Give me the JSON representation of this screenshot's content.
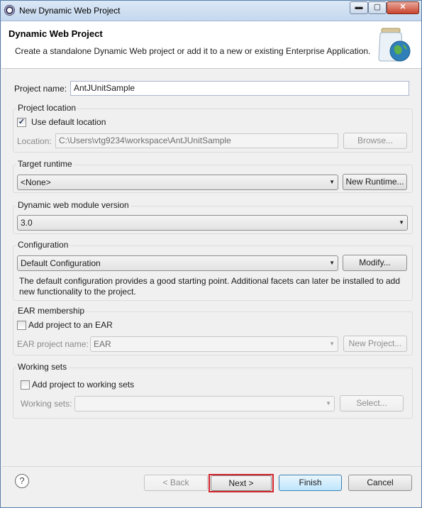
{
  "window": {
    "title": "New Dynamic Web Project",
    "controls": {
      "minimize": "▬",
      "maximize": "▢",
      "close": "✕"
    }
  },
  "header": {
    "title": "Dynamic Web Project",
    "description": "Create a standalone Dynamic Web project or add it to a new or existing Enterprise Application.",
    "graphic_icon": "jar-globe-icon"
  },
  "project_name": {
    "label": "Project name:",
    "value": "AntJUnitSample"
  },
  "project_location": {
    "group_title": "Project location",
    "use_default_label": "Use default location",
    "use_default_checked": true,
    "location_label": "Location:",
    "location_value": "C:\\Users\\vtg9234\\workspace\\AntJUnitSample",
    "browse_label": "Browse..."
  },
  "target_runtime": {
    "group_title": "Target runtime",
    "selected": "<None>",
    "new_runtime_label": "New Runtime..."
  },
  "web_module": {
    "group_title": "Dynamic web module version",
    "selected": "3.0"
  },
  "configuration": {
    "group_title": "Configuration",
    "selected": "Default Configuration",
    "modify_label": "Modify...",
    "description_line1": "The default configuration provides a good starting point. Additional facets can later be installed to add",
    "description_line2": "new functionality to the project."
  },
  "ear_membership": {
    "group_title": "EAR membership",
    "add_label": "Add project to an EAR",
    "add_checked": false,
    "ear_name_label": "EAR project name:",
    "ear_name_value": "EAR",
    "new_project_label": "New Project..."
  },
  "working_sets": {
    "group_title": "Working sets",
    "add_label": "Add project to working sets",
    "add_checked": false,
    "sets_label": "Working sets:",
    "sets_value": "",
    "select_label": "Select..."
  },
  "footer": {
    "help_glyph": "?",
    "back_label": "< Back",
    "next_label": "Next >",
    "finish_label": "Finish",
    "cancel_label": "Cancel"
  },
  "colors": {
    "highlight": "#d2232a",
    "window_border": "#5b7fa8",
    "primary_button": "#3c7fb1"
  }
}
